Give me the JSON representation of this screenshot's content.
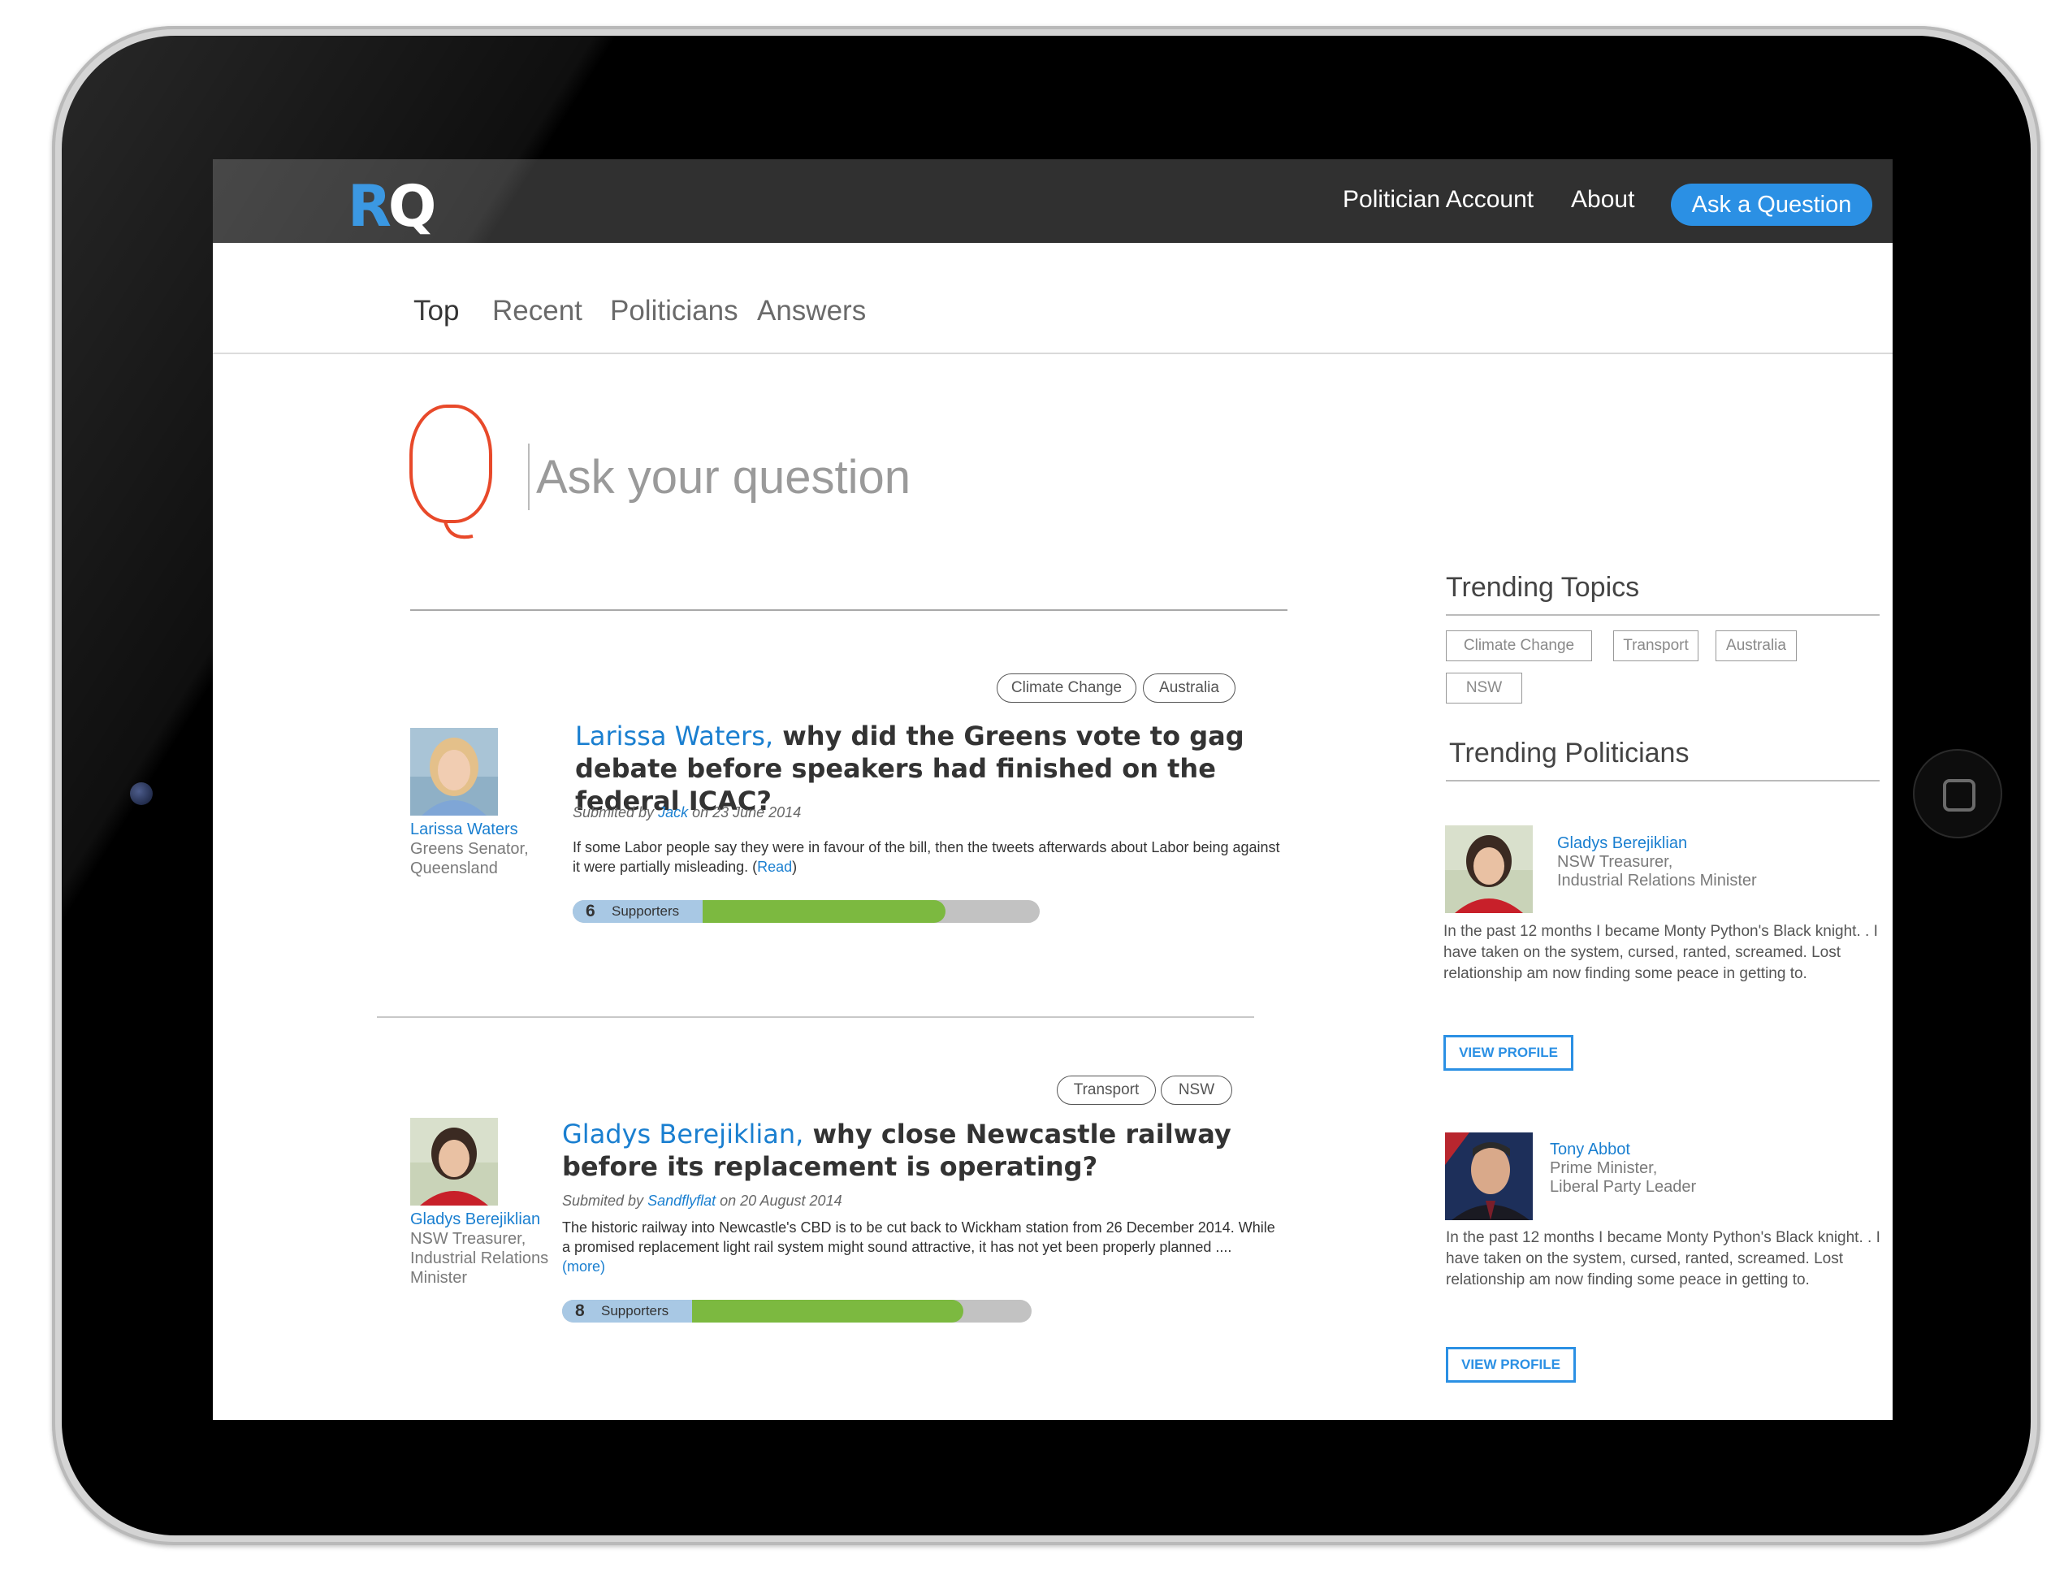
{
  "nav": {
    "logo_r": "R",
    "logo_q": "Q",
    "links": [
      "Politician Account",
      "About"
    ],
    "ask_button": "Ask a Question"
  },
  "tabs": [
    "Top",
    "Recent",
    "Politicians",
    "Answers"
  ],
  "ask": {
    "placeholder": "Ask your question"
  },
  "questions": [
    {
      "tags": [
        "Climate Change",
        "Australia"
      ],
      "person_name": "Larissa Waters",
      "person_role": "Greens Senator, Queensland",
      "title_who": "Larissa Waters,",
      "title_text": " why did the Greens vote to gag debate before speakers had finished on the federal ICAC?",
      "submitted_prefix": "Submited by ",
      "submitted_by": "Jack",
      "submitted_date": " on 23 June 2014",
      "body": "If some Labor people say they were in favour of the bill, then the tweets afterwards about Labor being against it were partially misleading. (",
      "more_label": "Read",
      "body_end": ")",
      "supporters": "6",
      "supporters_label": "Supporters",
      "support_level": 0.72
    },
    {
      "tags": [
        "Transport",
        "NSW"
      ],
      "person_name": "Gladys Berejiklian",
      "person_role": "NSW Treasurer, Industrial Relations Minister",
      "title_who": "Gladys Berejiklian,",
      "title_text": " why close Newcastle railway before its replacement is operating?",
      "submitted_prefix": "Submited by ",
      "submitted_by": "Sandflyflat",
      "submitted_date": " on 20 August 2014",
      "body": "The historic railway into Newcastle's CBD is to be cut back to Wickham station from 26 December 2014. While a promised replacement light rail system might sound attractive, it has not yet been properly planned .... ",
      "more_label": "(more)",
      "body_end": "",
      "supporters": "8",
      "supporters_label": "Supporters",
      "support_level": 0.8
    }
  ],
  "sidebar": {
    "topics_title": "Trending Topics",
    "topics": [
      "Climate Change",
      "Transport",
      "Australia",
      "NSW"
    ],
    "politicians_title": "Trending Politicians",
    "politicians": [
      {
        "name": "Gladys Berejiklian",
        "role_line1": "NSW Treasurer,",
        "role_line2": "Industrial Relations Minister",
        "bio": "In the past 12 months I became Monty Python's Black knight. . I have taken on the system, cursed, ranted, screamed. Lost relationship am now finding some peace in getting to.",
        "button": "VIEW PROFILE"
      },
      {
        "name": "Tony Abbot",
        "role_line1": "Prime Minister,",
        "role_line2": "Liberal Party Leader",
        "bio": "In the past 12 months I became Monty Python's Black knight. . I have taken on the system, cursed, ranted, screamed. Lost relationship am now finding some peace in getting to.",
        "button": "VIEW PROFILE"
      }
    ]
  },
  "colors": {
    "accent": "#2b90e4",
    "link": "#1a7fd0",
    "q_mark": "#e8492a",
    "bar_fill": "#7cb940",
    "bar_count": "#a8c8e4",
    "topbar": "#303030"
  }
}
